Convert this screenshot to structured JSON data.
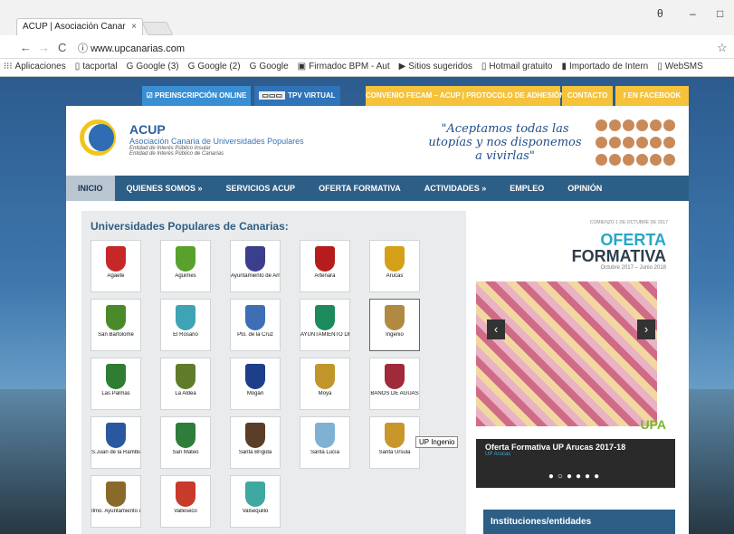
{
  "browser": {
    "tab_title": "ACUP | Asociación Canar",
    "tab_close": "×",
    "url": "www.upcanarias.com",
    "account_icon": "θ",
    "min": "–",
    "max": "□",
    "back": "←",
    "forward": "→",
    "reload": "C",
    "info_icon": "ⓘ",
    "star": "☆"
  },
  "bookmarks": [
    {
      "icon": "⁝⁝⁝",
      "label": "Aplicaciones"
    },
    {
      "icon": "▯",
      "label": "tacportal"
    },
    {
      "icon": "G",
      "label": "Google (3)"
    },
    {
      "icon": "G",
      "label": "Google (2)"
    },
    {
      "icon": "G",
      "label": "Google"
    },
    {
      "icon": "▣",
      "label": "Firmadoc BPM - Aut"
    },
    {
      "icon": "▶",
      "label": "Sitios sugeridos"
    },
    {
      "icon": "▯",
      "label": "Hotmail gratuito"
    },
    {
      "icon": "▮",
      "label": "Importado de Intern"
    },
    {
      "icon": "▯",
      "label": "WebSMS"
    }
  ],
  "top_buttons": {
    "preinscripcion": "☑ PREINSCRIPCIÓN ONLINE",
    "tpv": "TPV VIRTUAL",
    "convenio": "CONVENIO FECAM – ACUP | PROTOCOLO DE ADHESIÓN",
    "contacto": "CONTACTO",
    "facebook": "f EN FACEBOOK"
  },
  "header": {
    "brand": "ACUP",
    "brand_sub": "Asociación Canaria de Universidades Populares",
    "brand_l1": "Entidad de Interés Público Insular",
    "brand_l2": "Entidad de Interés Público de Canarias",
    "slogan": "\"Aceptamos todas las utopías y nos disponemos a vivirlas\""
  },
  "menu": [
    "INICIO",
    "QUIENES SOMOS »",
    "SERVICIOS ACUP",
    "OFERTA FORMATIVA",
    "ACTIVIDADES »",
    "EMPLEO",
    "OPINIÓN"
  ],
  "left": {
    "heading": "Universidades Populares de Canarias:",
    "tooltip": "UP Ingenio",
    "cells": [
      {
        "label": "Agaete",
        "color": "#c62828"
      },
      {
        "label": "Agüimes",
        "color": "#5aa02c"
      },
      {
        "label": "Ayuntamiento de Arrecife",
        "color": "#3b3e8c"
      },
      {
        "label": "Artenara",
        "color": "#b71c1c"
      },
      {
        "label": "Arucas",
        "color": "#d4a017"
      },
      {
        "label": "San Bartolomé",
        "color": "#4a8a2a"
      },
      {
        "label": "El Rosario",
        "color": "#3ea4b5"
      },
      {
        "label": "Pto. de la Cruz",
        "color": "#3e6fb5"
      },
      {
        "label": "AYUNTAMIENTO DE GÁLDAR",
        "color": "#1c8a5a"
      },
      {
        "label": "Ingenio",
        "color": "#b08a40"
      },
      {
        "label": "Las Palmas",
        "color": "#2e7d32"
      },
      {
        "label": "La Aldea",
        "color": "#5f7c2a"
      },
      {
        "label": "Mogán",
        "color": "#1d3f8a"
      },
      {
        "label": "Moya",
        "color": "#c0962a"
      },
      {
        "label": "BAÑOS DE AGUAS",
        "color": "#a02a3a"
      },
      {
        "label": "S.Juan de la Rambla",
        "color": "#2a58a0"
      },
      {
        "label": "San Mateo",
        "color": "#2f7d3a"
      },
      {
        "label": "Santa Brígida",
        "color": "#5a3e2a"
      },
      {
        "label": "Santa Lucía",
        "color": "#7fb2d2"
      },
      {
        "label": "Santa Úrsula",
        "color": "#c8962a"
      },
      {
        "label": "Ilmo. Ayuntamiento de Tejeda",
        "color": "#8a6a2a"
      },
      {
        "label": "Valleseco",
        "color": "#c83a2a"
      },
      {
        "label": "Valsequillo",
        "color": "#3fa8a0"
      }
    ]
  },
  "slider": {
    "top": "COMIENZO 1 DE OCTUBRE DE 2017",
    "oferta": "OFERTA",
    "formativa": "FORMATIVA",
    "dates": "Octubre 2017 – Junio 2018",
    "caption": "Oferta Formativa UP Arucas 2017-18",
    "caption_sub": "UP Arucas",
    "dots": "●○●●●●",
    "prev": "‹",
    "next": "›",
    "upa": "UPA"
  },
  "instituciones": "Instituciones/entidades"
}
